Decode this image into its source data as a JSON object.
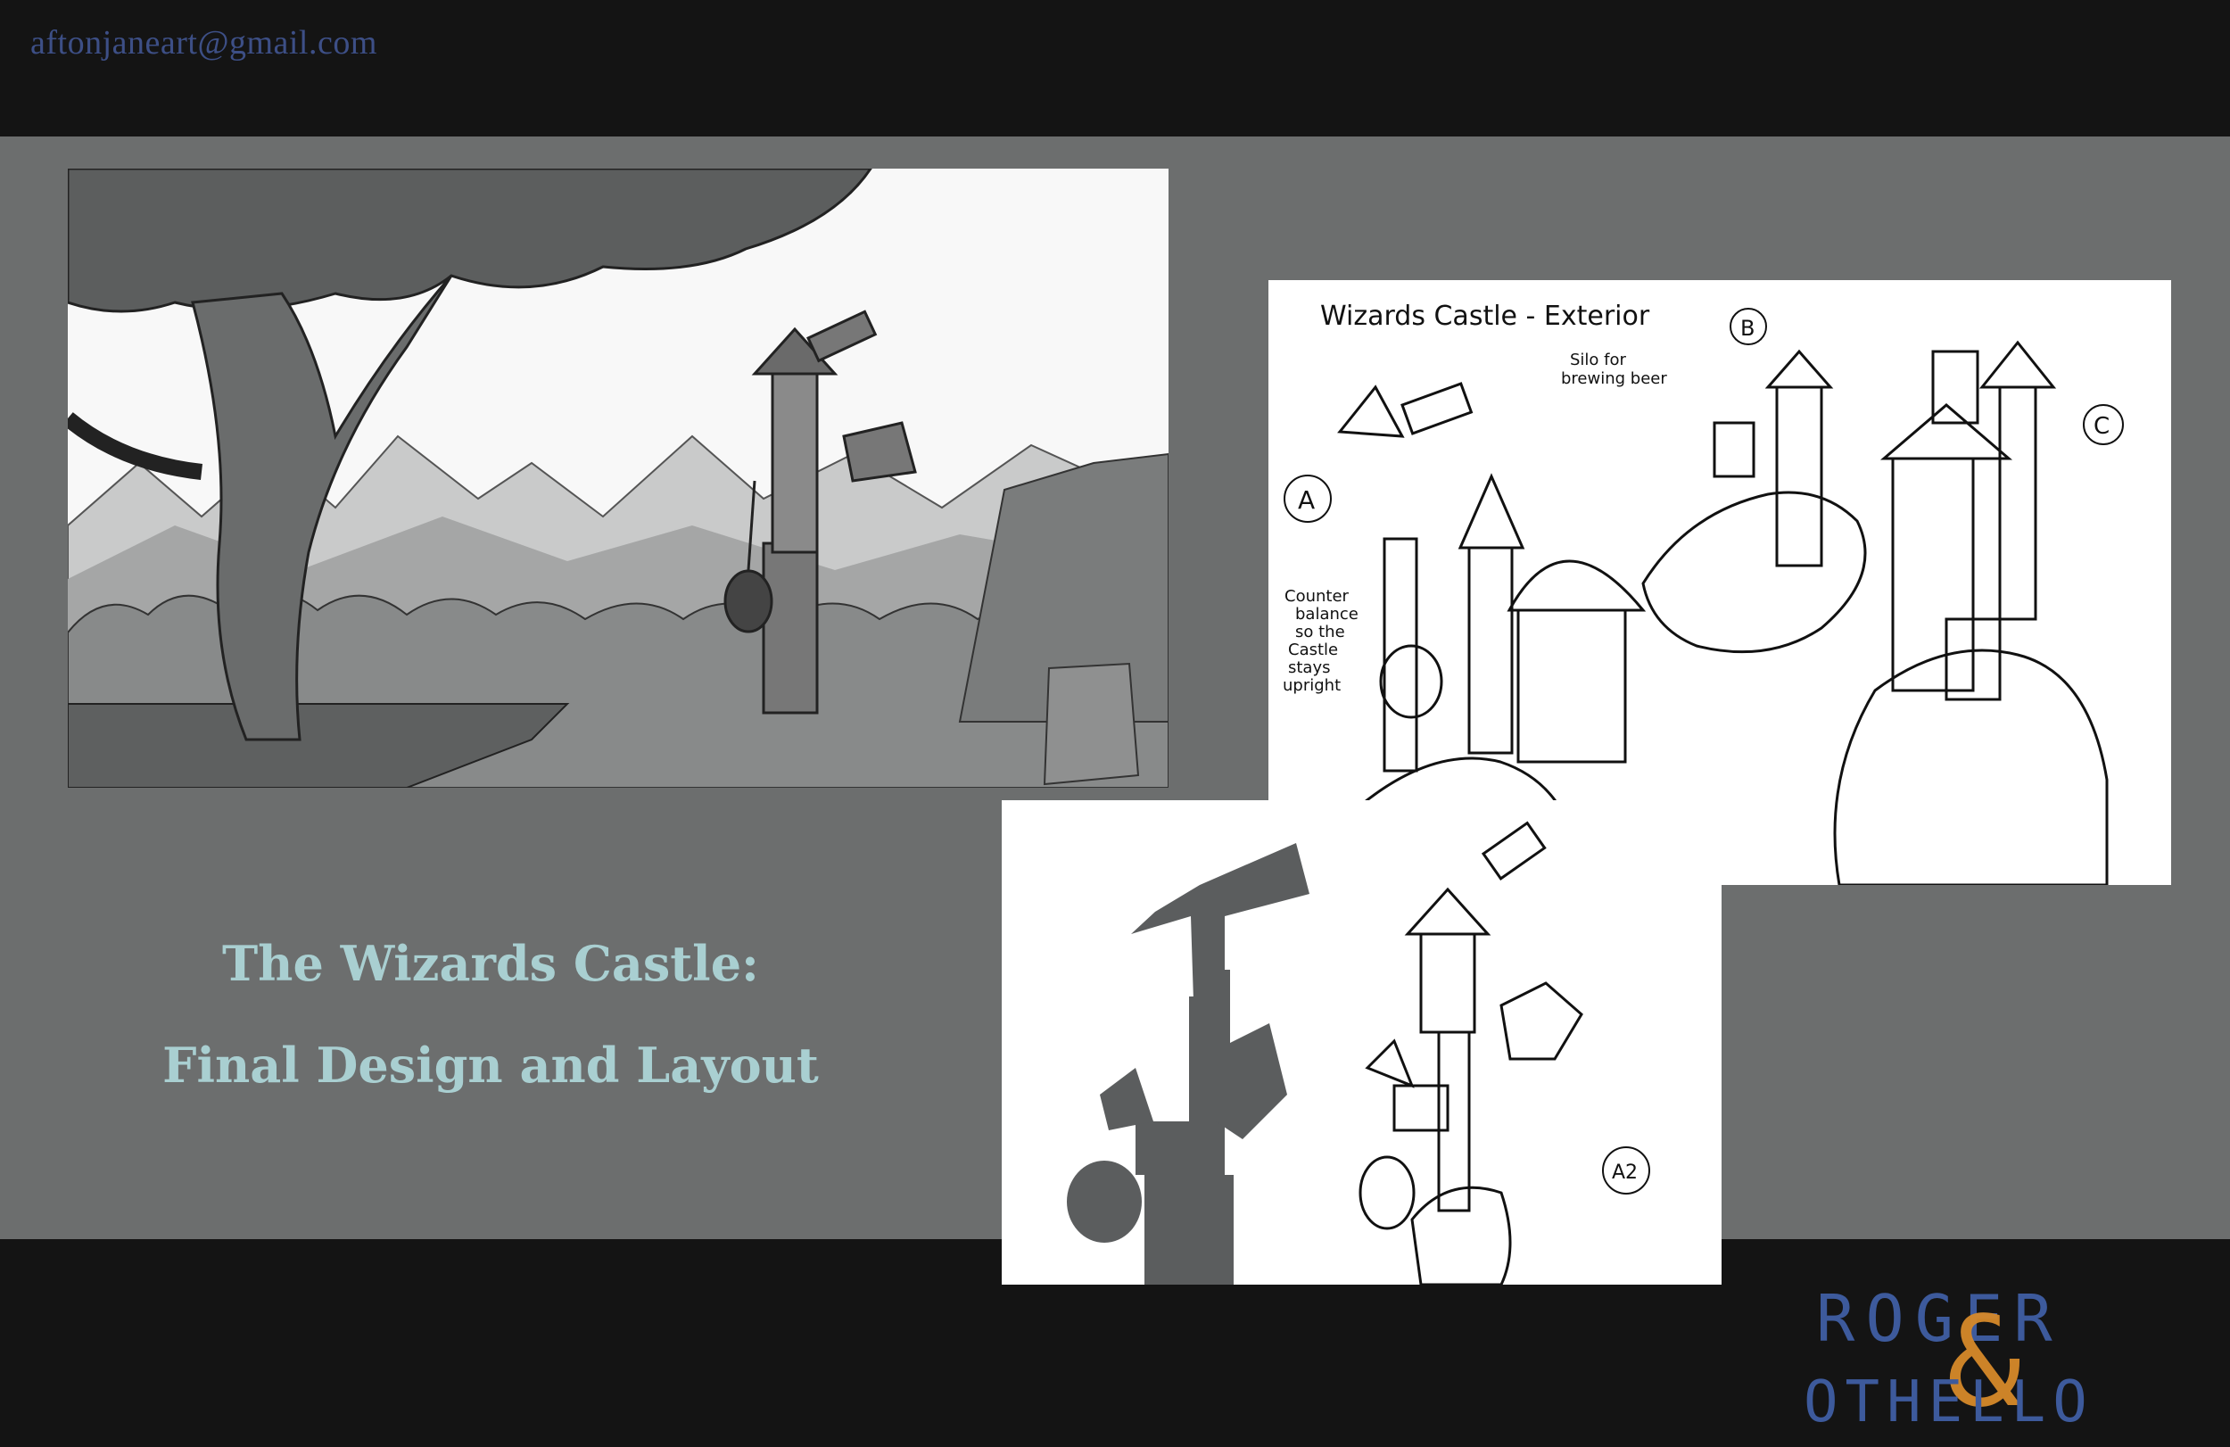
{
  "header": {
    "email": "aftonjaneart@gmail.com"
  },
  "title": {
    "line1": "The Wizards Castle:",
    "line2": "Final Design and Layout"
  },
  "sketch_sheet": {
    "heading": "Wizards Castle - Exterior",
    "labels": {
      "a": "A",
      "b": "B",
      "c": "C",
      "a2": "A2"
    },
    "notes": {
      "silo": [
        "Silo for",
        "brewing beer"
      ],
      "counter": [
        "Counter",
        "balance",
        "so the",
        "Castle",
        "stays",
        "upright"
      ]
    }
  },
  "logo": {
    "top": "ROGER",
    "amp": "&",
    "bottom": "OTHELLO"
  },
  "colors": {
    "top_band": "#141414",
    "mid_band": "#6c6e6e",
    "email": "#3d4f86",
    "title": "#a9cfd1",
    "logo_blue": "#3d5a9c",
    "logo_gold": "#d6892a"
  }
}
